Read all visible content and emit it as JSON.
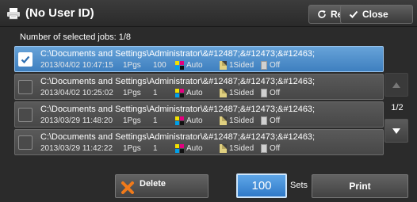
{
  "header": {
    "title": "(No User ID)",
    "refresh_label": "Refresh",
    "close_label": "Close"
  },
  "selection": {
    "count_text": "Number of selected jobs: 1/8"
  },
  "jobs": [
    {
      "path": "C:\\Documents and Settings\\Administrator\\&#12487;&#12473;&#12463;",
      "timestamp": "2013/04/02 10:47:15",
      "pages": "1Pgs",
      "copies": "100",
      "color": "Auto",
      "sided": "1Sided",
      "staple": "Off",
      "selected": true
    },
    {
      "path": "C:\\Documents and Settings\\Administrator\\&#12487;&#12473;&#12463;",
      "timestamp": "2013/04/02 10:25:02",
      "pages": "1Pgs",
      "copies": "1",
      "color": "Auto",
      "sided": "1Sided",
      "staple": "Off",
      "selected": false
    },
    {
      "path": "C:\\Documents and Settings\\Administrator\\&#12487;&#12473;&#12463;",
      "timestamp": "2013/03/29 11:48:20",
      "pages": "1Pgs",
      "copies": "1",
      "color": "Auto",
      "sided": "1Sided",
      "staple": "Off",
      "selected": false
    },
    {
      "path": "C:\\Documents and Settings\\Administrator\\&#12487;&#12473;&#12463;",
      "timestamp": "2013/03/29 11:42:22",
      "pages": "1Pgs",
      "copies": "1",
      "color": "Auto",
      "sided": "1Sided",
      "staple": "Off",
      "selected": false
    }
  ],
  "pager": {
    "indicator": "1/2"
  },
  "footer": {
    "delete_label": "Delete",
    "sets_value": "100",
    "sets_label": "Sets",
    "print_label": "Print"
  },
  "colors": {
    "selected_row": "#4f8fd0",
    "delete_x": "#f07a1a",
    "sets_field": "#3f8ad6"
  },
  "icons": {
    "title": "printer-icon",
    "refresh": "refresh-icon",
    "close": "check-icon",
    "delete": "x-icon",
    "scroll_up": "triangle-up-icon",
    "scroll_down": "triangle-down-icon"
  }
}
